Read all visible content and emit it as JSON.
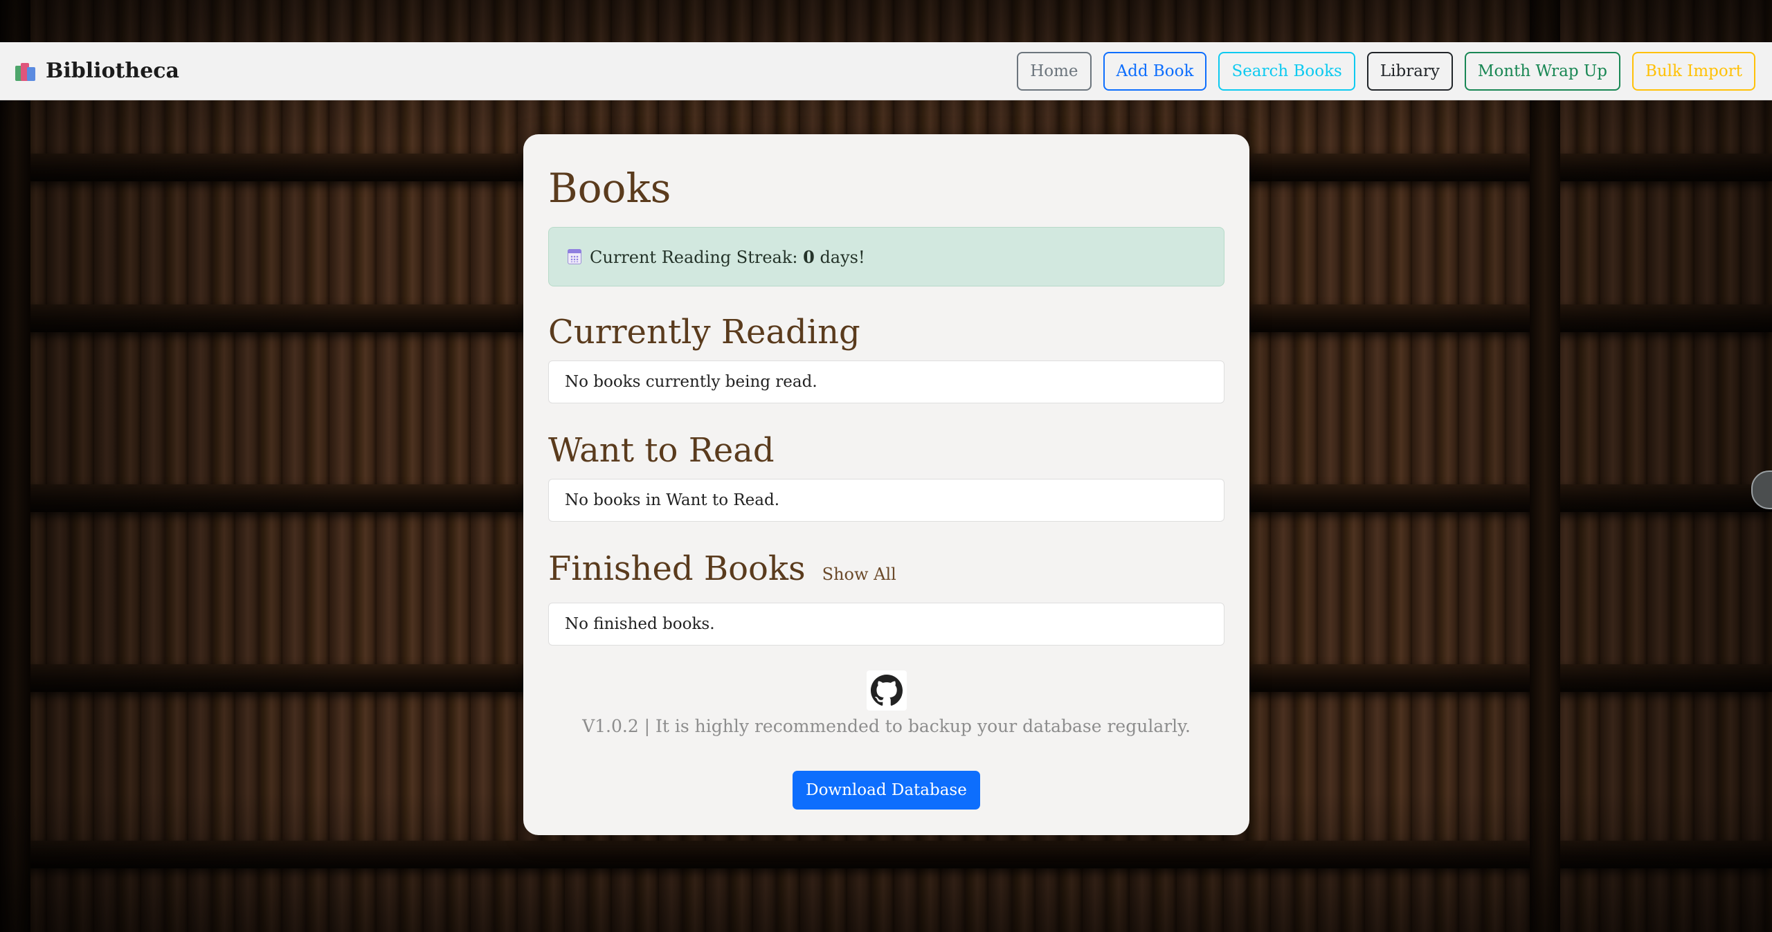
{
  "brand": {
    "name": "Bibliotheca",
    "icon": "books-icon"
  },
  "nav": [
    {
      "label": "Home",
      "color": "#6c757d"
    },
    {
      "label": "Add Book",
      "color": "#0d6efd"
    },
    {
      "label": "Search Books",
      "color": "#0dcaf0"
    },
    {
      "label": "Library",
      "color": "#212529"
    },
    {
      "label": "Month Wrap Up",
      "color": "#198754"
    },
    {
      "label": "Bulk Import",
      "color": "#ffc107"
    }
  ],
  "main": {
    "title": "Books",
    "streak": {
      "icon": "calendar-icon",
      "label": "Current Reading Streak: ",
      "count": "0",
      "suffix": " days!"
    },
    "currently_reading": {
      "title": "Currently Reading",
      "empty": "No books currently being read."
    },
    "want_to_read": {
      "title": "Want to Read",
      "empty": "No books in Want to Read."
    },
    "finished": {
      "title": "Finished Books",
      "link": "Show All",
      "empty": "No finished books."
    }
  },
  "footer": {
    "icon": "github-icon",
    "version_text": "V1.0.2 | It is highly recommended to backup your database regularly.",
    "download_label": "Download Database"
  }
}
